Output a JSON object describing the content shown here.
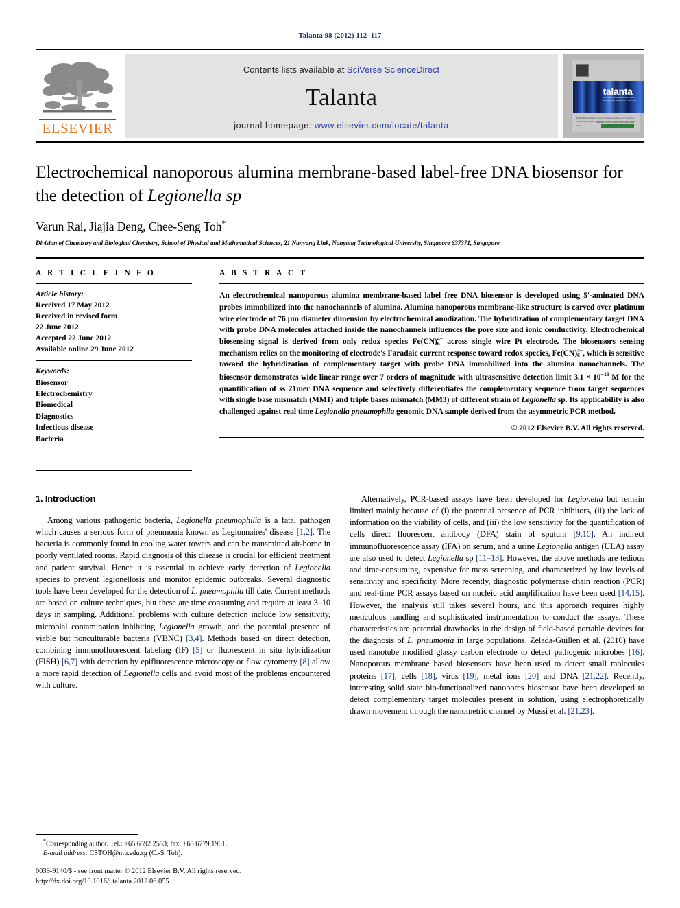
{
  "running_head": "Talanta 98 (2012) 112–117",
  "masthead": {
    "contents_prefix": "Contents lists available at ",
    "contents_link": "SciVerse ScienceDirect",
    "journal_title": "Talanta",
    "homepage_prefix": "journal homepage: ",
    "homepage_link": "www.elsevier.com/locate/talanta",
    "publisher_wordmark": "ELSEVIER",
    "cover_wordmark": "talanta",
    "cover_subtitle": "the international journal of pure and applied analytical chemistry",
    "cover_footer_left": "ELSEVIER\nAvailable online at www.sciencedirect.com\nSciVerse ScienceDirect\nISSN 0039-9140\nVolume 98  Number 1  15 August 2012",
    "cover_footer_right": "Available online at www.sciencedirect.com",
    "link_color": "#2b3fa0",
    "brand_orange": "#E87722"
  },
  "title": "Electrochemical nanoporous alumina membrane-based label-free DNA biosensor for the detection of ",
  "title_italic": "Legionella sp",
  "authors": "Varun Rai, Jiajia Deng, Chee-Seng Toh",
  "author_star": "*",
  "affiliation": "Division of Chemistry and Biological Chemistry, School of Physical and Mathematical Sciences, 21 Nanyang Link, Nanyang Technological University, Singapore 637371, Singapore",
  "article_info": {
    "heading": "A R T I C L E   I N F O",
    "history_label": "Article history:",
    "history": [
      "Received 17 May 2012",
      "Received in revised form",
      "22 June 2012",
      "Accepted 22 June 2012",
      "Available online 29 June 2012"
    ],
    "keywords_label": "Keywords:",
    "keywords": [
      "Biosensor",
      "Electrochemistry",
      "Biomedical",
      "Diagnostics",
      "Infectious disease",
      "Bacteria"
    ]
  },
  "abstract": {
    "heading": "A B S T R A C T",
    "part1": "An electrochemical nanoporous alumina membrane-based label free DNA biosensor is developed using 5′-aminated DNA probes immobilized into the nanochannels of alumina. Alumina nanoporous membrane-like structure is carved over platinum wire electrode of 76 μm diameter dimension by electrochemical anodization. The hybridization of complementary target DNA with probe DNA molecules attached inside the nanochannels influences the pore size and ionic conductivity. Electrochemical biosensing signal is derived from only redox species Fe(CN)",
    "redox_charge": "4−",
    "redox_count": "6",
    "part2": " across single wire Pt electrode. The biosensors sensing mechanism relies on the monitoring of electrode's Faradaic current response toward redox species, Fe(CN)",
    "part3": ", which is sensitive toward the hybridization of complementary target with probe DNA immobilized into the alumina nanochannels. The biosensor demonstrates wide linear range over 7 orders of magnitude with ultrasensitive detection limit 3.1 × 10",
    "detection_exp": "−19",
    "part4": " M for the quantification of ss 21mer DNA sequence and selectively differentiates the complementary sequence from target sequences with single base mismatch (MM1) and triple bases mismatch (MM3) of different strain of ",
    "italic1": "Legionella",
    "part5": " sp. Its applicability is also challenged against real time ",
    "italic2": "Legionella pneumophila",
    "part6": " genomic DNA sample derived from the asymmetric PCR method.",
    "copyright": "© 2012 Elsevier B.V. All rights reserved."
  },
  "body": {
    "intro_heading": "1.  Introduction",
    "left_p1_a": "Among various pathogenic bacteria, ",
    "left_p1_it1": "Legionella pneumophilia",
    "left_p1_b": " is a fatal pathogen which causes a serious form of pneumonia known as Legionnaires' disease ",
    "left_p1_r1": "[1,2]",
    "left_p1_c": ". The bacteria is commonly found in cooling water towers and can be transmitted air-borne in poorly ventilated rooms. Rapid diagnosis of this disease is crucial for efficient treatment and patient survival. Hence it is essential to achieve early detection of ",
    "left_p1_it2": "Legionella",
    "left_p1_d": " species to prevent legionellosis and monitor epidemic outbreaks. Several diagnostic tools have been developed for the detection of ",
    "left_p1_it3": "L. pneumophila",
    "left_p1_e": " till date. Current methods are based on culture techniques, but these are time consuming and require at least 3–10 days in sampling. Additional problems with culture detection include low sensitivity, microbial contamination inhibiting ",
    "left_p1_it4": "Legionella",
    "left_p1_f": " growth, and the potential presence of viable but nonculturable bacteria (VBNC) ",
    "left_p1_r2": "[3,4]",
    "left_p1_g": ". Methods based on direct detection, combining immunofluorescent labeling (IF) ",
    "left_p1_r3": "[5]",
    "left_p1_h": " or fluorescent in situ hybridization (FISH) ",
    "left_p1_r4": "[6,7]",
    "left_p1_i": " with detection by epifluorescence microscopy or flow cytometry ",
    "left_p1_r5": "[8]",
    "left_p1_j": " allow a more rapid detection of ",
    "left_p1_it5": "Legionella",
    "left_p1_k": " cells and avoid most of the problems encountered with culture.",
    "right_p1_a": "Alternatively, PCR-based assays have been developed for ",
    "right_p1_it1": "Legionella",
    "right_p1_b": " but remain limited mainly because of (i) the potential presence of PCR inhibitors, (ii) the lack of information on the viability of cells, and (iii) the low sensitivity for the quantification of cells direct fluorescent antibody (DFA) stain of sputum ",
    "right_p1_r1": "[9,10]",
    "right_p1_c": ". An indirect immunofluorescence assay (IFA) on serum, and a urine ",
    "right_p1_it2": "Legionella",
    "right_p1_d": " antigen (ULA) assay are also used to detect ",
    "right_p1_it3": "Legionella",
    "right_p1_e": " sp ",
    "right_p1_r2": "[11–13]",
    "right_p1_f": ". However, the above methods are tedious and time-consuming, expensive for mass screening, and characterized by low levels of sensitivity and specificity. More recently, diagnostic polymerase chain reaction (PCR) and real-time PCR assays based on nucleic acid amplification have been used ",
    "right_p1_r3": "[14,15]",
    "right_p1_g": ". However, the analysis still takes several hours, and this approach requires highly meticulous handling and sophisticated instrumentation to conduct the assays. These characteristics are potential drawbacks in the design of field-based portable devices for the diagnosis of ",
    "right_p1_it4": "L. pneumonia",
    "right_p1_h": " in large populations. Zelada-Guillen et al. (2010) have used nanotube modified glassy carbon electrode to detect pathogenic microbes ",
    "right_p1_r4": "[16]",
    "right_p1_i": ". Nanoporous membrane based biosensors have been used to detect small molecules proteins ",
    "right_p1_r5": "[17]",
    "right_p1_j": ", cells ",
    "right_p1_r6": "[18]",
    "right_p1_k": ", virus ",
    "right_p1_r7": "[19]",
    "right_p1_l": ", metal ions ",
    "right_p1_r8": "[20]",
    "right_p1_m": " and DNA ",
    "right_p1_r9": "[21,22]",
    "right_p1_n": ". Recently, interesting solid state bio-functionalized nanopores biosensor have been developed to detect complementary target molecules present in solution, using electrophoretically drawn movement through the nanometric channel by Mussi et al. ",
    "right_p1_r10": "[21,23]",
    "right_p1_o": "."
  },
  "footnotes": {
    "corresponding": "Corresponding author. Tel.: +65 6592 2553; fax: +65 6779 1961.",
    "email_label": "E-mail address:",
    "email_value": " CSTOH@ntu.edu.sg (C.-S. Toh).",
    "imprint_line1": "0039-9140/$ - see front matter © 2012 Elsevier B.V. All rights reserved.",
    "imprint_line2": "http://dx.doi.org/10.1016/j.talanta.2012.06.055"
  }
}
